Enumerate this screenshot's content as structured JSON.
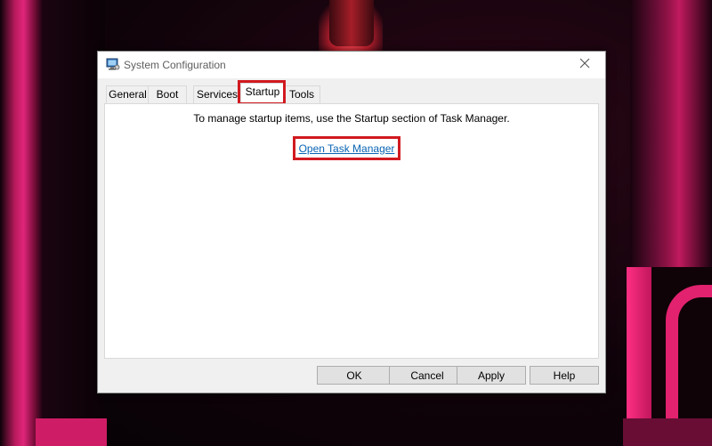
{
  "window": {
    "title": "System Configuration",
    "close_symbol": "✕"
  },
  "tabs": [
    {
      "label": "General",
      "active": false
    },
    {
      "label": "Boot",
      "active": false
    },
    {
      "label": "Services",
      "active": false
    },
    {
      "label": "Startup",
      "active": true
    },
    {
      "label": "Tools",
      "active": false
    }
  ],
  "startup_panel": {
    "message": "To manage startup items, use the Startup section of Task Manager.",
    "link_label": "Open Task Manager"
  },
  "buttons": {
    "ok": "OK",
    "cancel": "Cancel",
    "apply": "Apply",
    "help": "Help"
  },
  "colors": {
    "highlight": "#d11a20",
    "link": "#0a64b4",
    "wallpaper_accent": "#e0257a"
  },
  "icons": {
    "app": "system-configuration-icon",
    "close": "close-icon"
  }
}
